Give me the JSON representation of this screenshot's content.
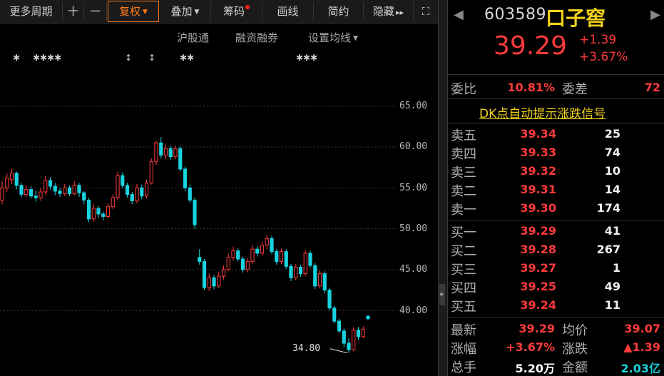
{
  "toolbar": {
    "items": [
      {
        "label": "更多周期",
        "name": "more-periods-button"
      },
      {
        "label": "十",
        "name": "crosshair-button"
      },
      {
        "label": "一",
        "name": "line-button"
      },
      {
        "label": "复权",
        "name": "adjust-button",
        "dropdown": true,
        "active": true
      },
      {
        "label": "叠加",
        "name": "overlay-button",
        "dropdown": true
      },
      {
        "label": "筹码",
        "name": "chips-button",
        "dot": true
      },
      {
        "label": "画线",
        "name": "draw-line-button"
      },
      {
        "label": "简约",
        "name": "simple-button"
      },
      {
        "label": "隐藏",
        "name": "hide-button",
        "more": "▸▸"
      },
      {
        "label": "⛶",
        "name": "fullscreen-button"
      }
    ],
    "active_color": "#ff7a1a"
  },
  "chart": {
    "links": [
      "沪股通",
      "融资融券",
      "设置均线"
    ],
    "price_labels": [
      "65.00",
      "60.00",
      "55.00",
      "50.00",
      "45.00",
      "40.00"
    ],
    "low_marker": "34.80",
    "markers": [
      "✱",
      "✱✱✱✱",
      "↕",
      "↕",
      "✱✱",
      "✱✱✱"
    ],
    "up_color": "#ff3b3b",
    "down_color": "#19d3e0"
  },
  "chart_data": {
    "type": "candlestick",
    "ylim": [
      34,
      69
    ],
    "yticks": [
      65,
      60,
      55,
      50,
      45,
      40
    ],
    "annotation": "34.80",
    "candles": [
      [
        53.5,
        55.0,
        55.8,
        53.0
      ],
      [
        55.0,
        56.2,
        56.8,
        54.5
      ],
      [
        56.0,
        56.8,
        57.3,
        55.5
      ],
      [
        56.8,
        55.3,
        57.0,
        54.8
      ],
      [
        55.3,
        54.2,
        55.6,
        53.8
      ],
      [
        54.2,
        54.8,
        55.3,
        53.9
      ],
      [
        54.8,
        54.0,
        55.2,
        53.7
      ],
      [
        54.0,
        53.8,
        54.6,
        53.3
      ],
      [
        53.8,
        54.5,
        55.0,
        53.4
      ],
      [
        54.5,
        55.9,
        56.4,
        54.2
      ],
      [
        55.9,
        55.2,
        56.3,
        54.8
      ],
      [
        55.2,
        54.6,
        55.6,
        54.1
      ],
      [
        54.6,
        54.3,
        55.0,
        53.9
      ],
      [
        54.3,
        55.0,
        55.5,
        54.0
      ],
      [
        55.0,
        54.3,
        55.3,
        54.0
      ],
      [
        54.3,
        55.3,
        55.8,
        54.1
      ],
      [
        55.3,
        54.4,
        55.6,
        53.9
      ],
      [
        54.4,
        53.5,
        54.6,
        53.0
      ],
      [
        53.5,
        51.2,
        53.8,
        50.8
      ],
      [
        51.2,
        52.5,
        53.0,
        50.9
      ],
      [
        52.5,
        51.8,
        52.8,
        51.3
      ],
      [
        51.8,
        51.5,
        52.1,
        51.0
      ],
      [
        51.5,
        52.7,
        53.1,
        51.3
      ],
      [
        52.7,
        53.8,
        54.2,
        52.4
      ],
      [
        53.8,
        56.5,
        57.0,
        53.5
      ],
      [
        56.5,
        55.3,
        56.9,
        55.0
      ],
      [
        55.3,
        54.2,
        55.6,
        53.8
      ],
      [
        54.2,
        53.4,
        54.5,
        53.0
      ],
      [
        53.4,
        55.0,
        55.5,
        53.1
      ],
      [
        55.0,
        54.0,
        55.4,
        53.6
      ],
      [
        54.0,
        55.6,
        56.0,
        53.7
      ],
      [
        55.6,
        58.2,
        58.6,
        55.4
      ],
      [
        58.2,
        60.5,
        60.8,
        57.8
      ],
      [
        60.5,
        59.0,
        61.2,
        58.6
      ],
      [
        59.0,
        59.8,
        60.3,
        58.5
      ],
      [
        59.8,
        58.8,
        60.1,
        58.4
      ],
      [
        58.8,
        59.8,
        60.2,
        58.5
      ],
      [
        59.8,
        57.3,
        60.1,
        57.0
      ],
      [
        57.3,
        55.0,
        57.6,
        54.6
      ],
      [
        55.0,
        53.5,
        55.4,
        53.2
      ],
      [
        53.5,
        50.5,
        53.8,
        50.0
      ],
      [
        46.5,
        46.0,
        47.5,
        45.6
      ],
      [
        46.0,
        42.8,
        46.3,
        42.5
      ],
      [
        42.8,
        44.0,
        44.5,
        42.4
      ],
      [
        44.0,
        43.0,
        44.3,
        42.6
      ],
      [
        43.0,
        44.2,
        44.7,
        42.8
      ],
      [
        44.2,
        45.0,
        45.5,
        43.8
      ],
      [
        45.0,
        46.5,
        47.0,
        44.8
      ],
      [
        46.5,
        47.3,
        47.8,
        46.1
      ],
      [
        47.3,
        46.3,
        47.6,
        46.0
      ],
      [
        46.3,
        45.0,
        46.6,
        44.6
      ],
      [
        45.0,
        46.0,
        46.4,
        44.7
      ],
      [
        46.0,
        47.5,
        48.0,
        45.7
      ],
      [
        47.5,
        47.0,
        47.9,
        46.6
      ],
      [
        47.0,
        48.0,
        48.4,
        46.7
      ],
      [
        48.0,
        48.8,
        49.2,
        47.5
      ],
      [
        48.8,
        47.2,
        49.1,
        46.9
      ],
      [
        47.2,
        46.0,
        47.5,
        45.6
      ],
      [
        46.0,
        47.2,
        47.6,
        45.7
      ],
      [
        47.2,
        45.4,
        47.5,
        45.1
      ],
      [
        45.4,
        44.0,
        45.7,
        43.6
      ],
      [
        44.0,
        45.3,
        45.7,
        43.7
      ],
      [
        45.3,
        44.5,
        45.6,
        44.1
      ],
      [
        44.5,
        47.0,
        47.4,
        44.2
      ],
      [
        47.0,
        45.5,
        47.3,
        45.2
      ],
      [
        45.5,
        43.0,
        45.8,
        42.6
      ],
      [
        43.0,
        44.5,
        44.9,
        42.7
      ],
      [
        44.5,
        42.5,
        44.8,
        42.1
      ],
      [
        42.5,
        40.3,
        42.8,
        40.0
      ],
      [
        40.3,
        38.7,
        40.6,
        38.4
      ],
      [
        38.7,
        37.5,
        39.0,
        37.2
      ],
      [
        37.5,
        36.0,
        37.8,
        35.5
      ],
      [
        36.0,
        35.2,
        36.6,
        34.8
      ],
      [
        35.2,
        37.6,
        37.9,
        35.0
      ],
      [
        37.6,
        36.8,
        38.0,
        36.4
      ],
      [
        36.8,
        37.7,
        38.1,
        36.6
      ],
      [
        39.3,
        39.0,
        39.5,
        38.8
      ]
    ]
  },
  "panel": {
    "code": "603589",
    "name": "口子窖",
    "price": "39.29",
    "change_abs": "+1.39",
    "change_pct": "+3.67%",
    "weibi_label": "委比",
    "weibi_value": "10.81%",
    "weicha_label": "委差",
    "weicha_value": "72",
    "dk_link": "DK点自动提示涨跌信号",
    "asks": [
      {
        "label": "卖五",
        "price": "39.34",
        "vol": "25"
      },
      {
        "label": "卖四",
        "price": "39.33",
        "vol": "74"
      },
      {
        "label": "卖三",
        "price": "39.32",
        "vol": "10"
      },
      {
        "label": "卖二",
        "price": "39.31",
        "vol": "14"
      },
      {
        "label": "卖一",
        "price": "39.30",
        "vol": "174"
      }
    ],
    "bids": [
      {
        "label": "买一",
        "price": "39.29",
        "vol": "41"
      },
      {
        "label": "买二",
        "price": "39.28",
        "vol": "267"
      },
      {
        "label": "买三",
        "price": "39.27",
        "vol": "1"
      },
      {
        "label": "买四",
        "price": "39.25",
        "vol": "49"
      },
      {
        "label": "买五",
        "price": "39.24",
        "vol": "11"
      }
    ],
    "stats": {
      "latest_label": "最新",
      "latest_value": "39.29",
      "avg_label": "均价",
      "avg_value": "39.07",
      "pct_label": "涨幅",
      "pct_value": "+3.67%",
      "chg_label": "涨跌",
      "chg_value": "▲1.39",
      "vol_label": "总手",
      "vol_value": "5.20万",
      "amt_label": "金额",
      "amt_value": "2.03亿"
    }
  }
}
